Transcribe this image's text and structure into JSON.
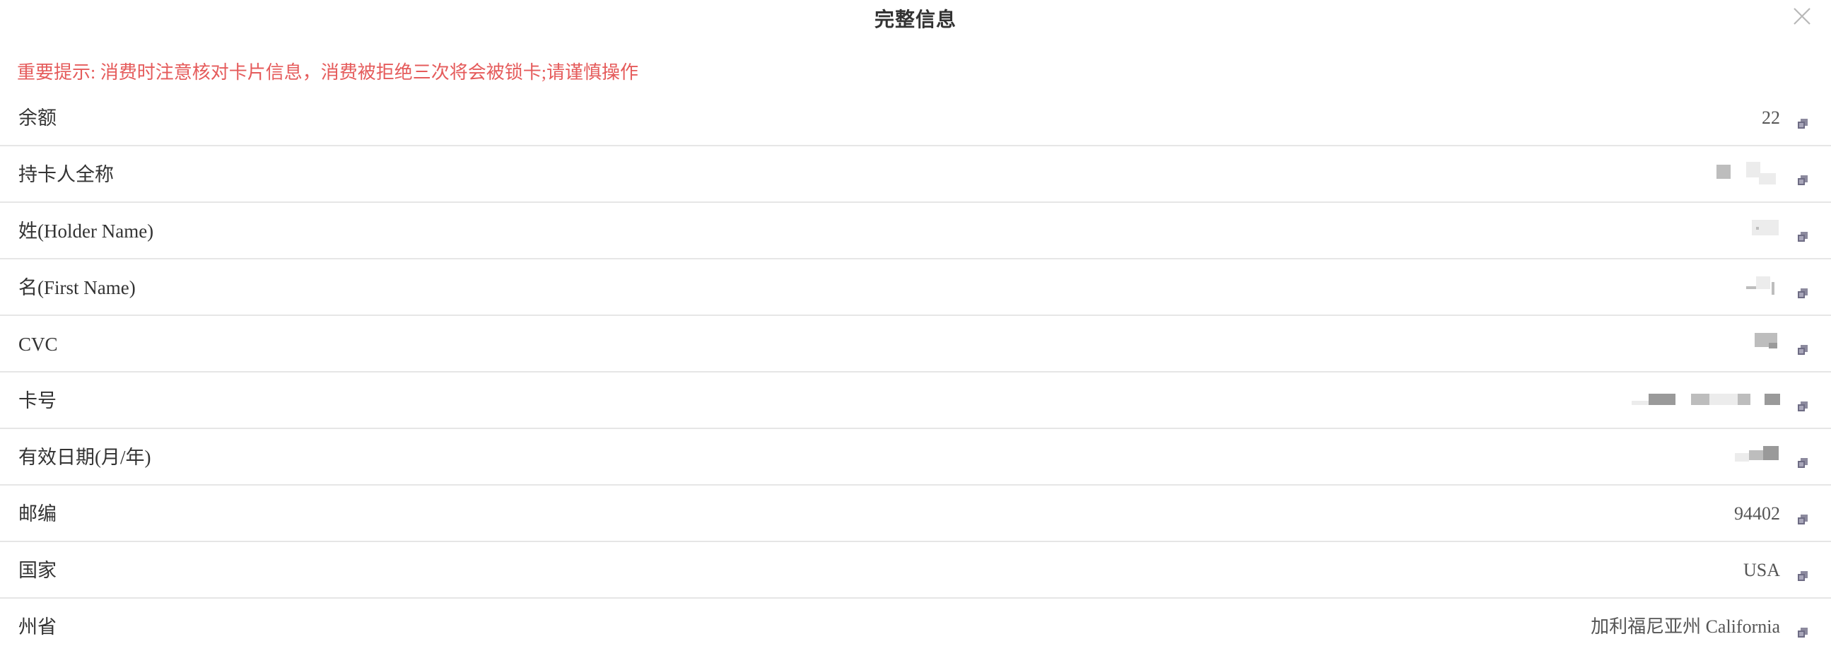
{
  "dialog": {
    "title": "完整信息",
    "close_icon": "close-icon"
  },
  "notice": {
    "text": "重要提示: 消费时注意核对卡片信息，消费被拒绝三次将会被锁卡;请谨慎操作",
    "color": "#e55b5b"
  },
  "rows": [
    {
      "label": "余额",
      "value": "22"
    },
    {
      "label": "持卡人全称",
      "value": ""
    },
    {
      "label": "姓(Holder Name)",
      "value": ""
    },
    {
      "label": "名(First Name)",
      "value": ""
    },
    {
      "label": "CVC",
      "value": ""
    },
    {
      "label": "卡号",
      "value": ""
    },
    {
      "label": "有效日期(月/年)",
      "value": ""
    },
    {
      "label": "邮编",
      "value": "94402"
    },
    {
      "label": "国家",
      "value": "USA"
    },
    {
      "label": "州省",
      "value": "加利福尼亚州 California"
    }
  ],
  "copy_icon": "copy-icon"
}
